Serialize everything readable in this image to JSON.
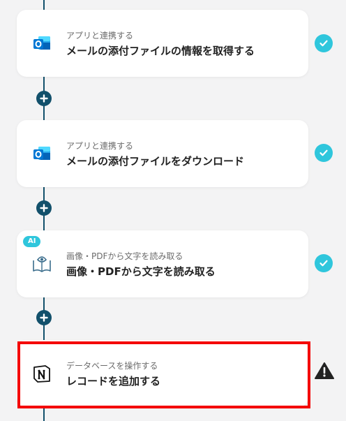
{
  "flow": {
    "steps": [
      {
        "action": "アプリと連携する",
        "title": "メールの添付ファイルの情報を取得する",
        "app_icon": "outlook-icon",
        "status": "complete"
      },
      {
        "action": "アプリと連携する",
        "title": "メールの添付ファイルをダウンロード",
        "app_icon": "outlook-icon",
        "status": "complete"
      },
      {
        "action": "画像・PDFから文字を読み取る",
        "title": "画像・PDFから文字を読み取る",
        "app_icon": "ocr-book-eye-icon",
        "badge": "AI",
        "status": "complete"
      },
      {
        "action": "データベースを操作する",
        "title": "レコードを追加する",
        "app_icon": "notion-icon",
        "status": "warning"
      }
    ]
  },
  "colors": {
    "connector": "#12506b",
    "complete": "#2fc6dc",
    "highlight": "#f40000",
    "outlook": "#0078d4"
  }
}
